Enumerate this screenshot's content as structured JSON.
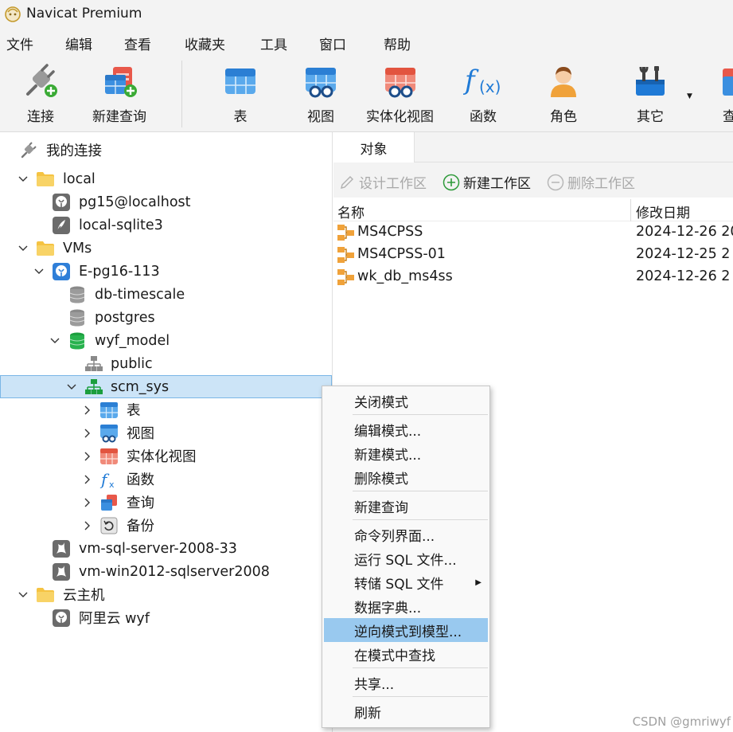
{
  "app": {
    "title": "Navicat Premium"
  },
  "menubar": [
    {
      "label": "文件"
    },
    {
      "label": "编辑"
    },
    {
      "label": "查看"
    },
    {
      "label": "收藏夹"
    },
    {
      "label": "工具"
    },
    {
      "label": "窗口"
    },
    {
      "label": "帮助"
    }
  ],
  "toolbar": {
    "connect": "连接",
    "new_query": "新建查询",
    "table": "表",
    "view": "视图",
    "materialized_view": "实体化视图",
    "function": "函数",
    "role": "角色",
    "other": "其它",
    "query_partial": "查"
  },
  "tree": {
    "root": "我的连接",
    "nodes": [
      {
        "label": "local"
      },
      {
        "label": "pg15@localhost"
      },
      {
        "label": "local-sqlite3"
      },
      {
        "label": "VMs"
      },
      {
        "label": "E-pg16-113"
      },
      {
        "label": "db-timescale"
      },
      {
        "label": "postgres"
      },
      {
        "label": "wyf_model"
      },
      {
        "label": "public"
      },
      {
        "label": "scm_sys"
      },
      {
        "label": "表"
      },
      {
        "label": "视图"
      },
      {
        "label": "实体化视图"
      },
      {
        "label": "函数"
      },
      {
        "label": "查询"
      },
      {
        "label": "备份"
      },
      {
        "label": "vm-sql-server-2008-33"
      },
      {
        "label": "vm-win2012-sqlserver2008"
      },
      {
        "label": "云主机"
      },
      {
        "label": "阿里云 wyf"
      }
    ]
  },
  "right": {
    "tab": "对象",
    "ws_toolbar": {
      "design": "设计工作区",
      "new": "新建工作区",
      "delete": "删除工作区"
    },
    "columns": {
      "name": "名称",
      "modified": "修改日期"
    },
    "rows": [
      {
        "name": "MS4CPSS",
        "date": "2024-12-26 20"
      },
      {
        "name": "MS4CPSS-01",
        "date": "2024-12-25 2"
      },
      {
        "name": "wk_db_ms4ss",
        "date": "2024-12-26 2"
      }
    ]
  },
  "context_menu": {
    "items": [
      {
        "label": "关闭模式"
      },
      {
        "label": "编辑模式..."
      },
      {
        "label": "新建模式..."
      },
      {
        "label": "删除模式"
      },
      {
        "label": "新建查询"
      },
      {
        "label": "命令列界面..."
      },
      {
        "label": "运行 SQL 文件..."
      },
      {
        "label": "转储 SQL 文件",
        "submenu": true
      },
      {
        "label": "数据字典..."
      },
      {
        "label": "逆向模式到模型...",
        "highlighted": true
      },
      {
        "label": "在模式中查找"
      },
      {
        "label": "共享..."
      },
      {
        "label": "刷新"
      }
    ]
  },
  "watermark": "CSDN @gmriwyf",
  "colors": {
    "selection_bg": "#cce4f7",
    "menu_highlight": "#99c9ef",
    "folder": "#f5c342",
    "toolbar_bg": "#f3f3f3"
  }
}
